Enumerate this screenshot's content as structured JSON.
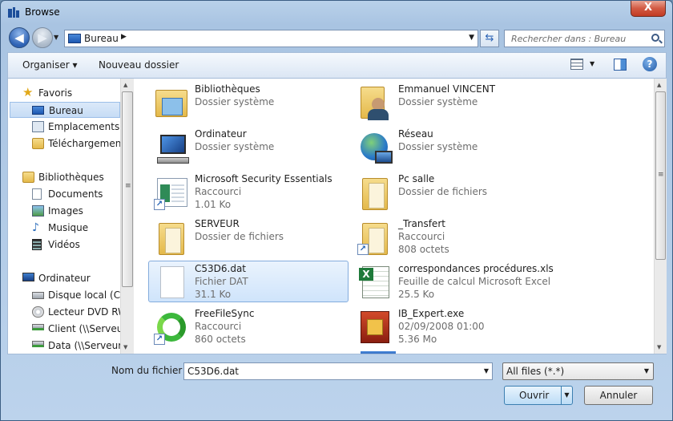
{
  "window": {
    "title": "Browse",
    "close_label": "X"
  },
  "navbar": {
    "back_glyph": "◀",
    "forward_glyph": "▶",
    "address": "Bureau",
    "address_separator": "▶",
    "search_placeholder": "Rechercher dans : Bureau"
  },
  "toolbar": {
    "organize": "Organiser ▾",
    "new_folder": "Nouveau dossier",
    "help": "?"
  },
  "nav": {
    "favorites": {
      "label": "Favoris",
      "items": [
        "Bureau",
        "Emplacements ré",
        "Téléchargements"
      ]
    },
    "libraries": {
      "label": "Bibliothèques",
      "items": [
        "Documents",
        "Images",
        "Musique",
        "Vidéos"
      ]
    },
    "computer": {
      "label": "Ordinateur",
      "items": [
        "Disque local (C:)",
        "Lecteur DVD RW",
        "Client (\\\\Serveur)",
        "Data (\\\\Serveur) ("
      ]
    },
    "selected": "Bureau"
  },
  "files": [
    {
      "name": "Bibliothèques",
      "l2": "Dossier système",
      "l3": "",
      "icon": "libraries-icon"
    },
    {
      "name": "Emmanuel VINCENT",
      "l2": "Dossier système",
      "l3": "",
      "icon": "user-folder-icon"
    },
    {
      "name": "Ordinateur",
      "l2": "Dossier système",
      "l3": "",
      "icon": "computer-icon"
    },
    {
      "name": "Réseau",
      "l2": "Dossier système",
      "l3": "",
      "icon": "network-icon"
    },
    {
      "name": "Microsoft Security Essentials",
      "l2": "Raccourci",
      "l3": "1.01 Ko",
      "icon": "security-shortcut-icon"
    },
    {
      "name": "Pc salle",
      "l2": "Dossier de fichiers",
      "l3": "",
      "icon": "folder-icon"
    },
    {
      "name": "SERVEUR",
      "l2": "Dossier de fichiers",
      "l3": "",
      "icon": "folder-icon"
    },
    {
      "name": "_Transfert",
      "l2": "Raccourci",
      "l3": "808 octets",
      "icon": "folder-shortcut-icon"
    },
    {
      "name": "C53D6.dat",
      "l2": "Fichier DAT",
      "l3": "31.1 Ko",
      "icon": "file-icon"
    },
    {
      "name": "correspondances procédures.xls",
      "l2": "Feuille de calcul Microsoft Excel",
      "l3": "25.5 Ko",
      "icon": "excel-icon"
    },
    {
      "name": "FreeFileSync",
      "l2": "Raccourci",
      "l3": "860 octets",
      "icon": "sync-shortcut-icon"
    },
    {
      "name": "IB_Expert.exe",
      "l2": "02/09/2008 01:00",
      "l3": "5.36 Mo",
      "icon": "exe-icon"
    }
  ],
  "footer": {
    "filename_label": "Nom du fichier :",
    "filename_value": "C53D6.dat",
    "filter_value": "All files (*.*)",
    "open_label": "Ouvrir",
    "cancel_label": "Annuler"
  }
}
